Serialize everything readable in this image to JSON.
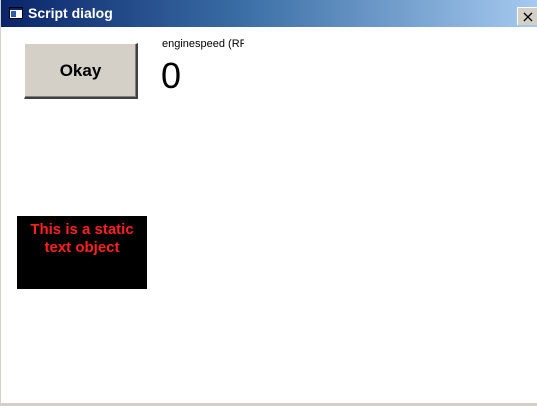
{
  "window": {
    "title": "Script dialog",
    "close_glyph": "×",
    "title_icon": "app-window-icon"
  },
  "dialog": {
    "okay_label": "Okay",
    "readout": {
      "label": "enginespeed (RPM",
      "value": "0"
    },
    "static_text": {
      "line1": "This is a static",
      "line2": "text object",
      "text_color": "#ff2020",
      "background_color": "#000000"
    }
  },
  "colors": {
    "titlebar_start": "#0a246a",
    "titlebar_end": "#a6caf0",
    "button_face": "#d4d0c8"
  }
}
